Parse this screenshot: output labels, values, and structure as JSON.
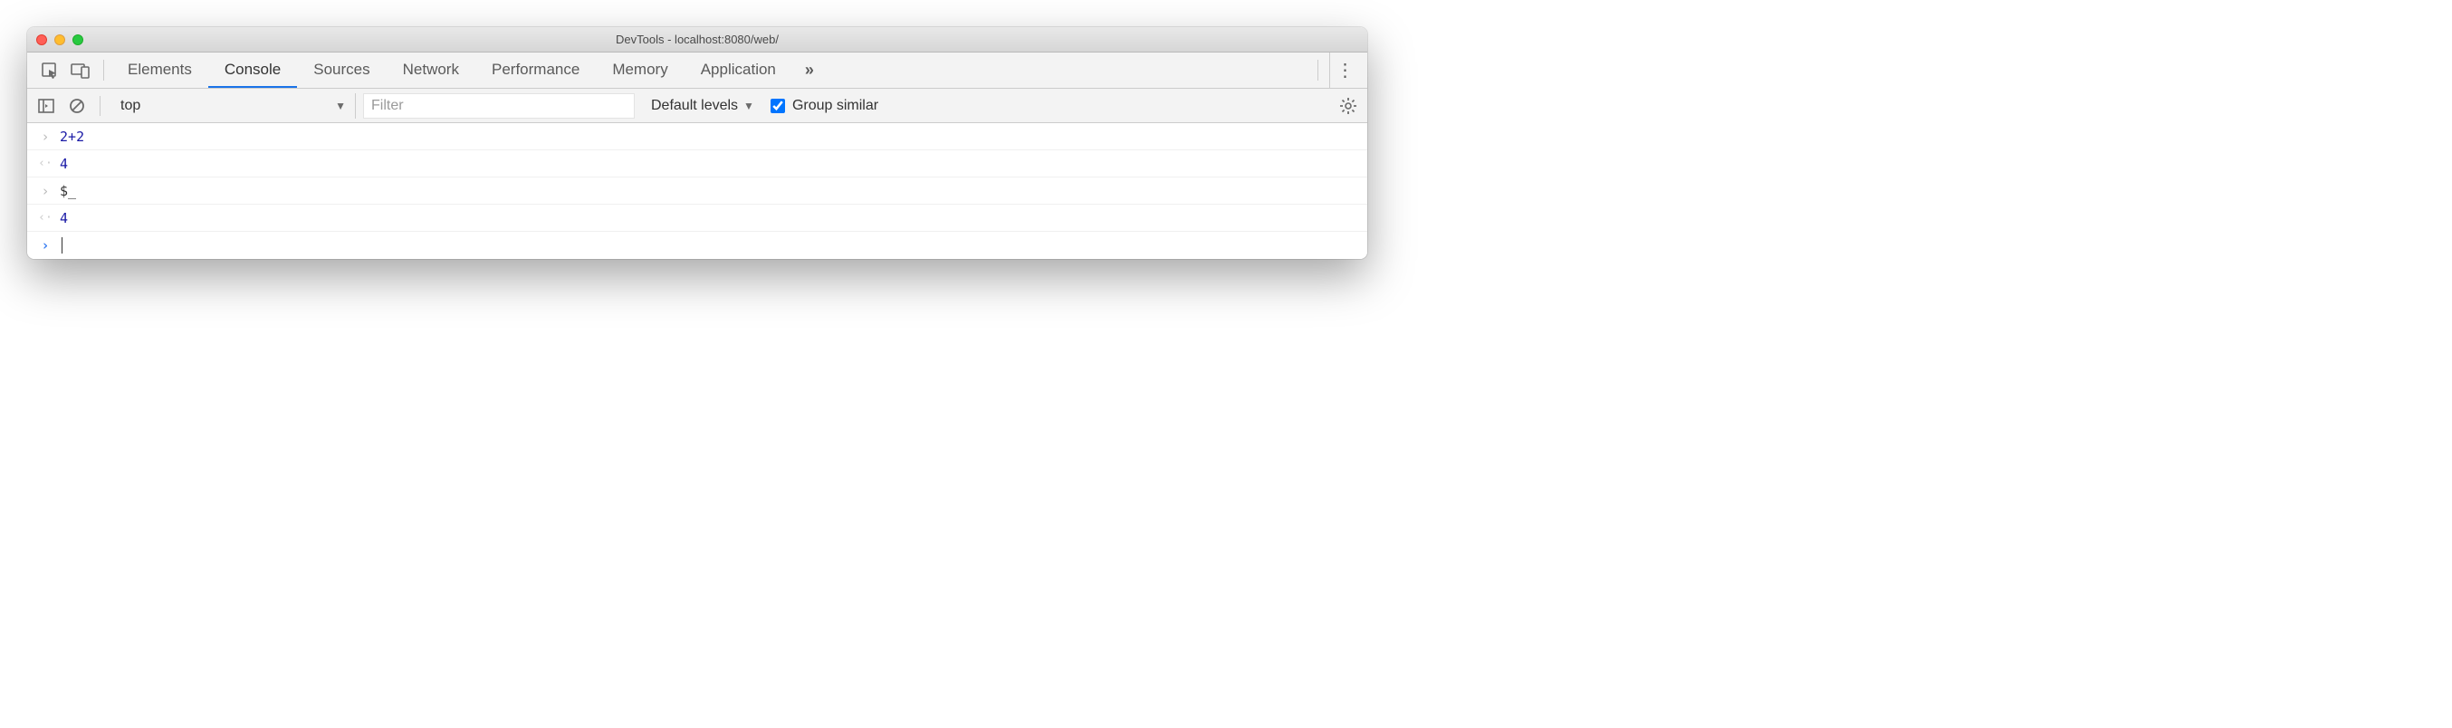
{
  "window": {
    "title": "DevTools - localhost:8080/web/"
  },
  "tabs": {
    "items": [
      {
        "label": "Elements",
        "active": false
      },
      {
        "label": "Console",
        "active": true
      },
      {
        "label": "Sources",
        "active": false
      },
      {
        "label": "Network",
        "active": false
      },
      {
        "label": "Performance",
        "active": false
      },
      {
        "label": "Memory",
        "active": false
      },
      {
        "label": "Application",
        "active": false
      }
    ],
    "overflow_glyph": "»"
  },
  "console_toolbar": {
    "context_selected": "top",
    "filter_placeholder": "Filter",
    "filter_value": "",
    "levels_label": "Default levels",
    "group_similar_label": "Group similar",
    "group_similar_checked": true
  },
  "console": {
    "rows": [
      {
        "kind": "input",
        "tokens": [
          {
            "t": "num",
            "v": "2"
          },
          {
            "t": "op",
            "v": "+"
          },
          {
            "t": "num",
            "v": "2"
          }
        ]
      },
      {
        "kind": "output",
        "tokens": [
          {
            "t": "num",
            "v": "4"
          }
        ]
      },
      {
        "kind": "input",
        "tokens": [
          {
            "t": "var",
            "v": "$_"
          }
        ]
      },
      {
        "kind": "output",
        "tokens": [
          {
            "t": "num",
            "v": "4"
          }
        ]
      }
    ],
    "prompt_glyph": "›"
  }
}
